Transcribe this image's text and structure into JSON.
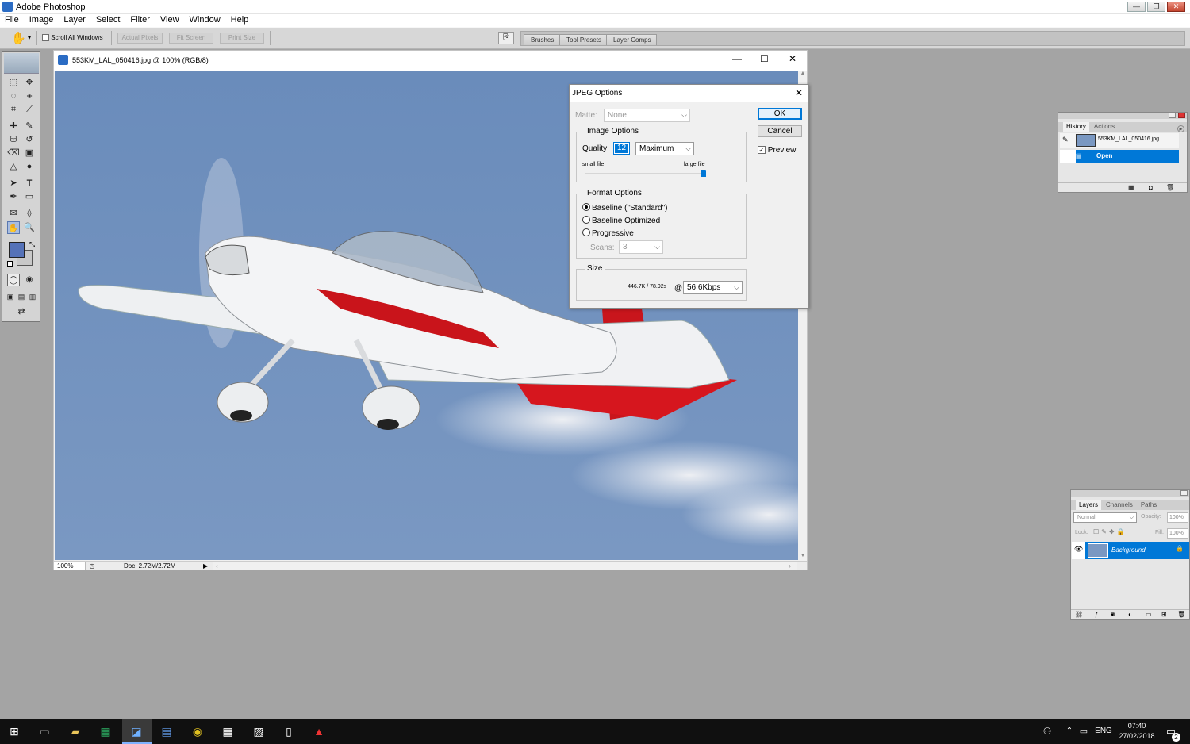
{
  "app": {
    "title": "Adobe Photoshop",
    "win_min": "—",
    "win_max": "❐",
    "win_close": "✕"
  },
  "menu": [
    "File",
    "Image",
    "Layer",
    "Select",
    "Filter",
    "View",
    "Window",
    "Help"
  ],
  "options_bar": {
    "scroll_all_windows": "Scroll All Windows",
    "actual_pixels": "Actual Pixels",
    "fit_screen": "Fit Screen",
    "print_size": "Print Size",
    "well_tabs": [
      "Brushes",
      "Tool Presets",
      "Layer Comps"
    ]
  },
  "document": {
    "title": "553KM_LAL_050416.jpg @ 100% (RGB/8)",
    "zoom": "100%",
    "doc_size": "Doc: 2.72M/2.72M"
  },
  "jpeg_dialog": {
    "title": "JPEG Options",
    "matte_label": "Matte:",
    "matte_value": "None",
    "image_options_label": "Image Options",
    "quality_label": "Quality:",
    "quality_value": "12",
    "quality_preset": "Maximum",
    "small_file": "small file",
    "large_file": "large file",
    "quality_slider_fraction": 1.0,
    "format_options_label": "Format Options",
    "format_options": [
      "Baseline (\"Standard\")",
      "Baseline Optimized",
      "Progressive"
    ],
    "selected_format": 0,
    "scans_label": "Scans:",
    "scans_value": "3",
    "size_label": "Size",
    "size_value": "~446.7K / 78.92s",
    "at": "@",
    "modem": "56.6Kbps",
    "ok": "OK",
    "cancel": "Cancel",
    "preview": "Preview",
    "preview_checked": true
  },
  "history_panel": {
    "tabs": [
      "History",
      "Actions"
    ],
    "snapshot": "553KM_LAL_050416.jpg",
    "state": "Open"
  },
  "layers_panel": {
    "tabs": [
      "Layers",
      "Channels",
      "Paths"
    ],
    "blend_mode": "Normal",
    "opacity_label": "Opacity:",
    "opacity_value": "100%",
    "lock_label": "Lock:",
    "fill_label": "Fill:",
    "fill_value": "100%",
    "layer_name": "Background"
  },
  "taskbar": {
    "language": "ENG",
    "time": "07:40",
    "date": "27/02/2018",
    "notif_count": "2"
  },
  "colors": {
    "accent": "#0078d7",
    "foreground_swatch": "#5572b8",
    "photo_sky": "#6e8fbc",
    "plane_red": "#d6161e"
  }
}
